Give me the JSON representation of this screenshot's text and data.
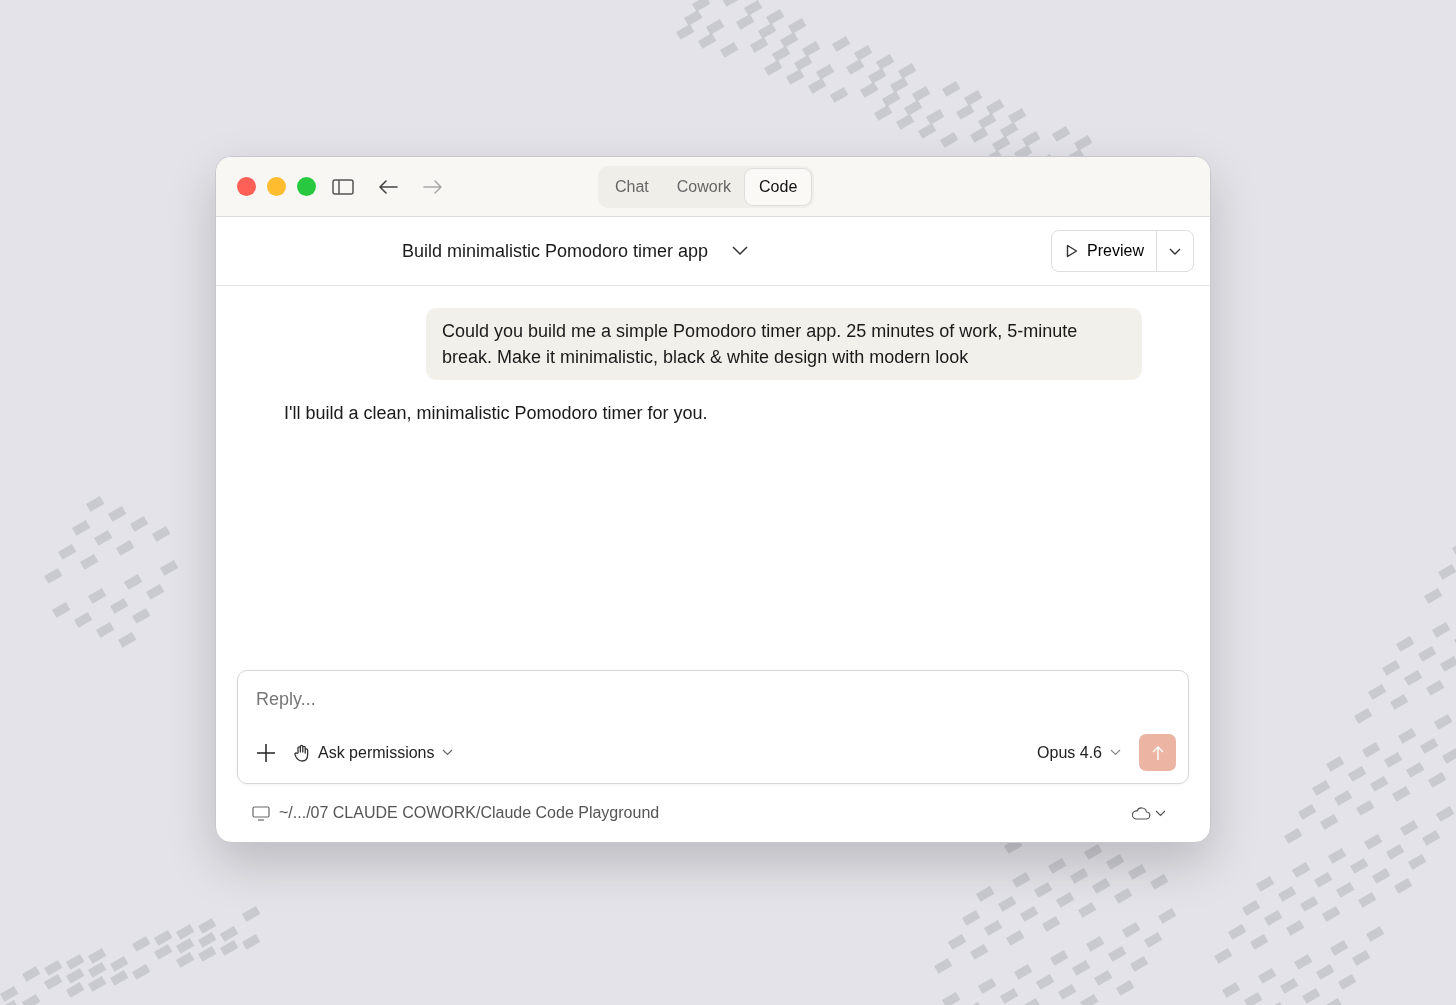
{
  "window": {
    "nav_buttons": [
      {
        "kind": "back",
        "disabled": false
      },
      {
        "kind": "forward",
        "disabled": true
      }
    ]
  },
  "mode_tabs": [
    {
      "label": "Chat",
      "selected": false
    },
    {
      "label": "Cowork",
      "selected": false
    },
    {
      "label": "Code",
      "selected": true
    }
  ],
  "header": {
    "title": "Build minimalistic Pomodoro timer app",
    "preview_button": "Preview"
  },
  "messages": [
    {
      "kind": "user",
      "text": "Could you build me a simple Pomodoro timer app. 25 minutes of work, 5-minute break. Make it minimalistic, black & white design with modern look"
    },
    {
      "kind": "assistant",
      "text": "I'll build a clean, minimalistic Pomodoro timer for you."
    }
  ],
  "composer": {
    "placeholder": "Reply...",
    "permissions": "Ask permissions",
    "model": "Opus 4.6",
    "send_disabled": true
  },
  "footer": {
    "path": "~/.../07 CLAUDE COWORK/Claude Code Playground"
  }
}
